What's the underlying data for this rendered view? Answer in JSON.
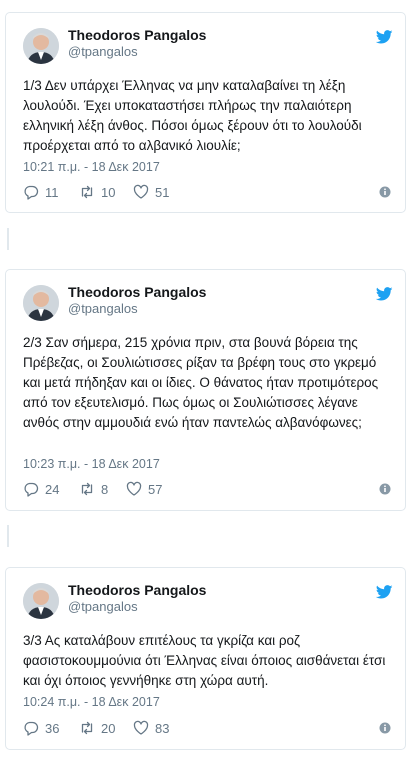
{
  "tweets": [
    {
      "author": "Theodoros Pangalos",
      "handle": "@tpangalos",
      "text": "1/3 Δεν υπάρχει Έλληνας να μην καταλαβαίνει τη λέξη λουλούδι. Έχει υποκαταστήσει πλήρως την παλαιότερη ελληνική λέξη άνθος. Πόσοι όμως ξέρουν ότι το λουλούδι προέρχεται από το αλβανικό λιουλίε;",
      "timestamp": "10:21 π.μ. - 18 Δεκ 2017",
      "replies": "11",
      "retweets": "10",
      "likes": "51"
    },
    {
      "author": "Theodoros Pangalos",
      "handle": "@tpangalos",
      "text": "2/3 Σαν σήμερα, 215 χρόνια πριν, στα βουνά βόρεια της Πρέβεζας, οι Σουλιώτισσες ρίξαν τα βρέφη τους στο γκρεμό και μετά πήδηξαν και οι ίδιες. Ο θάνατος ήταν προτιμότερος από τον εξευτελισμό. Πως όμως οι Σουλιώτισσες λέγανε ανθός στην αμμουδιά ενώ ήταν παντελώς αλβανόφωνες;",
      "timestamp": "10:23 π.μ. - 18 Δεκ 2017",
      "replies": "24",
      "retweets": "8",
      "likes": "57"
    },
    {
      "author": "Theodoros Pangalos",
      "handle": "@tpangalos",
      "text": "3/3 Ας καταλάβουν επιτέλους τα γκρίζα και ροζ φασιστοκουμμούνια ότι Έλληνας είναι όποιος αισθάνεται έτσι και όχι όποιος γεννήθηκε στη χώρα αυτή.",
      "timestamp": "10:24 π.μ. - 18 Δεκ 2017",
      "replies": "36",
      "retweets": "20",
      "likes": "83"
    }
  ],
  "icons": {
    "brand": "twitter-bird-icon",
    "reply": "reply-icon",
    "retweet": "retweet-icon",
    "like": "heart-icon",
    "info": "info-icon"
  },
  "colors": {
    "twitter_blue": "#1da1f2",
    "text_primary": "#14171a",
    "text_secondary": "#657786",
    "border": "#e1e8ed"
  }
}
